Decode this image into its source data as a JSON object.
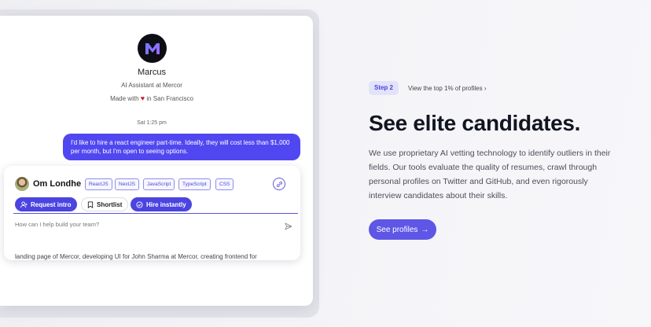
{
  "chat": {
    "avatar_letter": "M",
    "name": "Marcus",
    "role": "AI Assistant at Mercor",
    "made_prefix": "Made with",
    "made_suffix": "in San Francisco",
    "timestamp": "Sat 1:25 pm",
    "user_message": "I'd like to hire a react engineer part-time. Ideally, they will cost less than $1,000 per month, but I'm open to seeing options.",
    "input_placeholder": "How can I help build your team?",
    "snippet": "landing page of Mercor, developing UI for John Sharma at Mercor, creating frontend for"
  },
  "candidate": {
    "name": "Om Londhe",
    "tags": [
      "ReactJS",
      "NextJS",
      "JavaScript",
      "TypeScript",
      "CSS"
    ],
    "buttons": {
      "request_intro": "Request intro",
      "shortlist": "Shortlist",
      "hire_instantly": "Hire instantly"
    }
  },
  "hero": {
    "step_label": "Step 2",
    "step_link": "View the top 1% of profiles",
    "headline": "See elite candidates.",
    "description": "We use proprietary AI vetting technology to identify outliers in their fields. Our tools evaluate the quality of resumes, crawl through personal profiles on Twitter and GitHub, and even rigorously interview candidates about their skills.",
    "cta": "See profiles"
  },
  "colors": {
    "accent": "#5147f0",
    "heart": "#c81d3a"
  }
}
